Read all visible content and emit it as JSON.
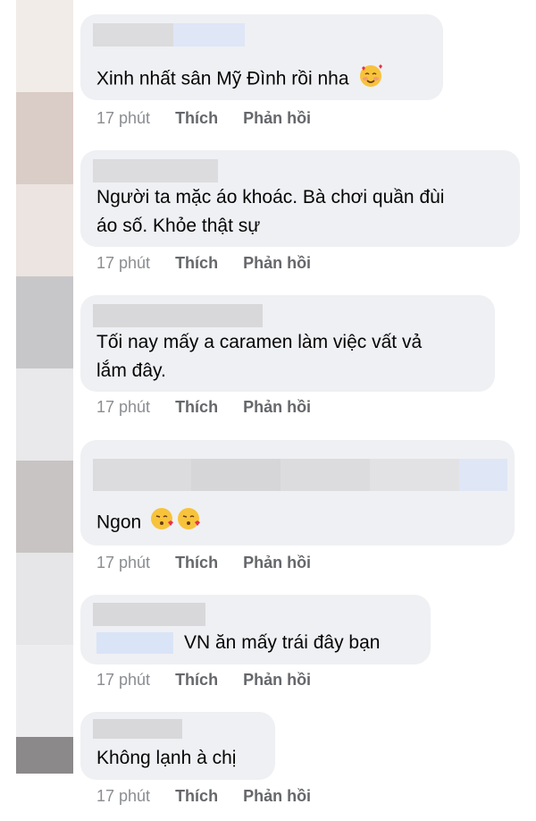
{
  "comments": [
    {
      "text": "Xinh nhất sân Mỹ Đình rồi nha",
      "emoji": "smiling-face-with-hearts",
      "time": "17 phút",
      "like": "Thích",
      "reply": "Phản hồi"
    },
    {
      "text_line1": "Người ta mặc áo khoác. Bà chơi quần đùi",
      "text_line2": "áo số. Khỏe thật sự",
      "time": "17 phút",
      "like": "Thích",
      "reply": "Phản hồi"
    },
    {
      "text_line1": "Tối nay mấy a caramen làm việc vất vả",
      "text_line2": "lắm đây.",
      "time": "17 phút",
      "like": "Thích",
      "reply": "Phản hồi"
    },
    {
      "text": "Ngon",
      "emoji": "face-blowing-kiss",
      "time": "17 phút",
      "like": "Thích",
      "reply": "Phản hồi"
    },
    {
      "text": "VN ăn mấy trái đây bạn",
      "time": "17 phút",
      "like": "Thích",
      "reply": "Phản hồi"
    },
    {
      "text": "Không lạnh à chị",
      "time": "17 phút",
      "like": "Thích",
      "reply": "Phản hồi"
    }
  ]
}
